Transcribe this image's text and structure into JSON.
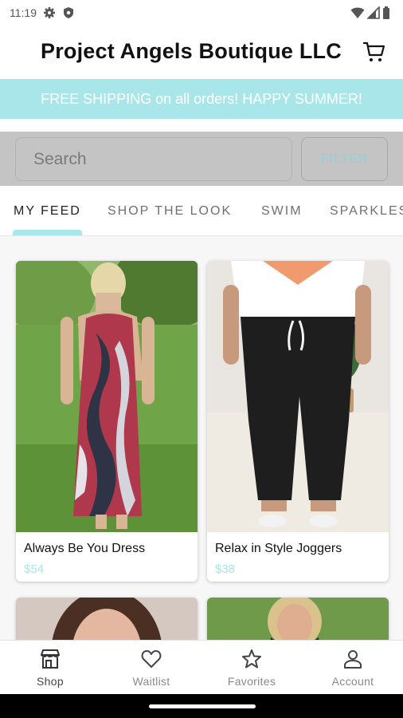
{
  "status_bar": {
    "time": "11:19",
    "icons": [
      "gear-icon",
      "shield-icon",
      "wifi-icon",
      "signal-icon",
      "battery-icon"
    ]
  },
  "header": {
    "title": "Project Angels Boutique LLC",
    "cart_icon": "cart-icon"
  },
  "promo": {
    "text": "FREE SHIPPING on all orders! HAPPY SUMMER!",
    "background": "#a9e6e9"
  },
  "search": {
    "placeholder": "Search",
    "filter_label": "FILTER"
  },
  "tabs": [
    {
      "label": "MY FEED",
      "active": true
    },
    {
      "label": "SHOP THE LOOK",
      "active": false
    },
    {
      "label": "SWIM",
      "active": false
    },
    {
      "label": "SPARKLES",
      "active": false
    }
  ],
  "products": [
    {
      "name": "Always Be You Dress",
      "price": "$54"
    },
    {
      "name": "Relax in Style Joggers",
      "price": "$38"
    }
  ],
  "bottom_nav": [
    {
      "label": "Shop",
      "icon": "store-icon",
      "active": true
    },
    {
      "label": "Waitlist",
      "icon": "heart-icon",
      "active": false
    },
    {
      "label": "Favorites",
      "icon": "star-icon",
      "active": false
    },
    {
      "label": "Account",
      "icon": "person-icon",
      "active": false
    }
  ],
  "colors": {
    "accent": "#a9e6e9",
    "search_bg": "#c4c4c4",
    "price": "#a9e6e9"
  }
}
